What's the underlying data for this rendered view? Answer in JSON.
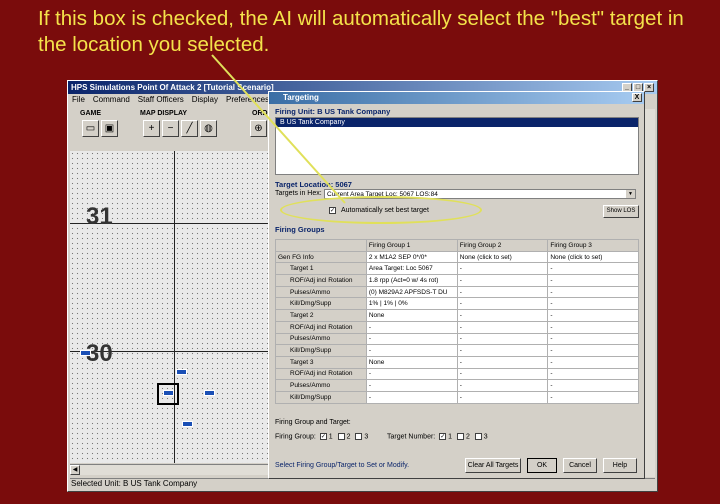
{
  "caption": "If this box is checked, the AI will automatically select the \"best\" target in the location you selected.",
  "app": {
    "title": "HPS Simulations Point Of Attack 2 [Tutorial Scenario]",
    "menu": [
      "File",
      "Command",
      "Staff Officers",
      "Display",
      "Preferences"
    ],
    "toolbar_groups": [
      "GAME",
      "MAP DISPLAY",
      "ORD"
    ],
    "hex_numbers": [
      "31",
      "30"
    ],
    "status": "Selected Unit: B  US Tank Company"
  },
  "dialog": {
    "title": "Targeting",
    "close": "X",
    "firing_unit_label": "Firing Unit: B  US Tank Company",
    "unit_list": [
      "B  US Tank Company"
    ],
    "target_location_label": "Target Location: 5067",
    "targets_in_hex_label": "Targets in Hex:",
    "targets_in_hex_value": "Current Area Target Loc: 5067 LOS:84",
    "auto_best_label": "Automatically set best target",
    "auto_best_checked": true,
    "show_los": "Show LOS",
    "firing_groups_label": "Firing Groups",
    "grid": {
      "headers": [
        "",
        "Firing Group 1",
        "Firing Group 2",
        "Firing Group 3"
      ],
      "rows": [
        {
          "label": "Gen FG Info",
          "indent": false,
          "cells": [
            "2 x M1A2 SEP 0*/0*",
            "None (click to set)",
            "None (click to set)"
          ]
        },
        {
          "label": "Target 1",
          "indent": true,
          "cells": [
            "Area Target:  Loc 5067",
            "-",
            "-"
          ]
        },
        {
          "label": "ROF/Adj incl Rotation",
          "indent": true,
          "cells": [
            "1.8 rpp (Act=0 w/ 4s rot)",
            "-",
            "-"
          ]
        },
        {
          "label": "Pulses/Ammo",
          "indent": true,
          "cells": [
            "(0) M829A2 APFSDS-T DU",
            "-",
            "-"
          ]
        },
        {
          "label": "Kill/Dmg/Supp",
          "indent": true,
          "cells": [
            "1% | 1% | 0%",
            "-",
            "-"
          ]
        },
        {
          "label": "Target 2",
          "indent": true,
          "cells": [
            "None",
            "-",
            "-"
          ]
        },
        {
          "label": "ROF/Adj incl Rotation",
          "indent": true,
          "cells": [
            "-",
            "-",
            "-"
          ]
        },
        {
          "label": "Pulses/Ammo",
          "indent": true,
          "cells": [
            "-",
            "-",
            "-"
          ]
        },
        {
          "label": "Kill/Dmg/Supp",
          "indent": true,
          "cells": [
            "-",
            "-",
            "-"
          ]
        },
        {
          "label": "Target 3",
          "indent": true,
          "cells": [
            "None",
            "-",
            "-"
          ]
        },
        {
          "label": "ROF/Adj incl Rotation",
          "indent": true,
          "cells": [
            "-",
            "-",
            "-"
          ]
        },
        {
          "label": "Pulses/Ammo",
          "indent": true,
          "cells": [
            "-",
            "-",
            "-"
          ]
        },
        {
          "label": "Kill/Dmg/Supp",
          "indent": true,
          "cells": [
            "-",
            "-",
            "-"
          ]
        }
      ]
    },
    "fg_target_label": "Firing Group and Target:",
    "firing_group_label": "Firing Group:",
    "target_number_label": "Target Number:",
    "choices": [
      "1",
      "2",
      "3"
    ],
    "hint": "Select Firing Group/Target to Set or Modify.",
    "clear_all": "Clear All Targets",
    "ok": "OK",
    "cancel": "Cancel",
    "help": "Help"
  },
  "colors": {
    "background": "#7a0c0c",
    "caption": "#f4e24a",
    "highlight": "#e0e05a",
    "unit": "#1a4fb5"
  }
}
